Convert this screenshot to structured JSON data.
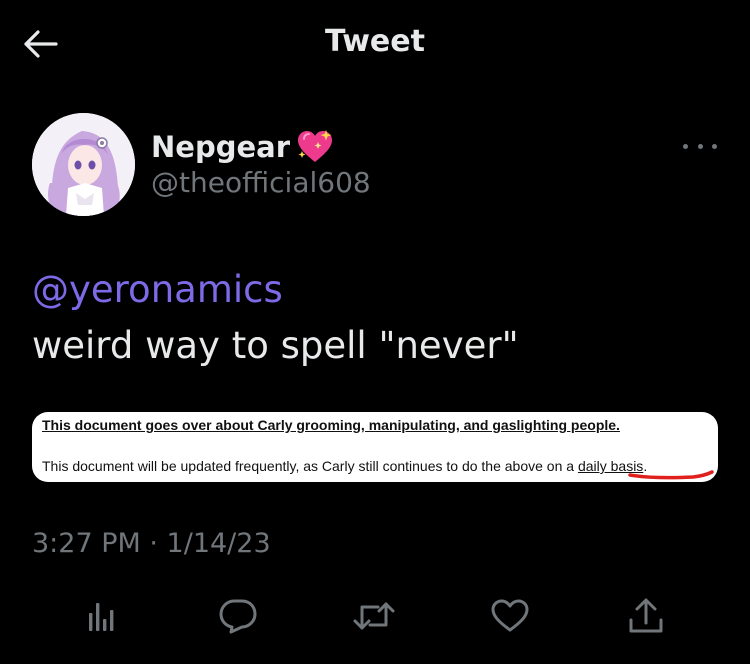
{
  "header": {
    "title": "Tweet"
  },
  "author": {
    "name": "Nepgear",
    "handle": "@theofficial608"
  },
  "tweet": {
    "mention": "@yeronamics",
    "text": "weird way to spell \"never\""
  },
  "attachment": {
    "line1": "This document goes over about Carly grooming, manipulating, and gaslighting people.",
    "line2_prefix": "This document will be updated frequently, as Carly still continues to do the above on a ",
    "line2_underlined": "daily basis",
    "line2_suffix": "."
  },
  "meta": {
    "time": "3:27 PM",
    "separator": " · ",
    "date": "1/14/23"
  },
  "colors": {
    "background": "#000000",
    "text": "#e7e9ea",
    "secondary": "#71767b",
    "mention": "#7c6ae6",
    "annotation": "#e0201c"
  },
  "icons": [
    "back-arrow-icon",
    "sparkling-heart-icon",
    "more-icon",
    "analytics-icon",
    "reply-icon",
    "retweet-icon",
    "like-icon",
    "share-icon"
  ]
}
